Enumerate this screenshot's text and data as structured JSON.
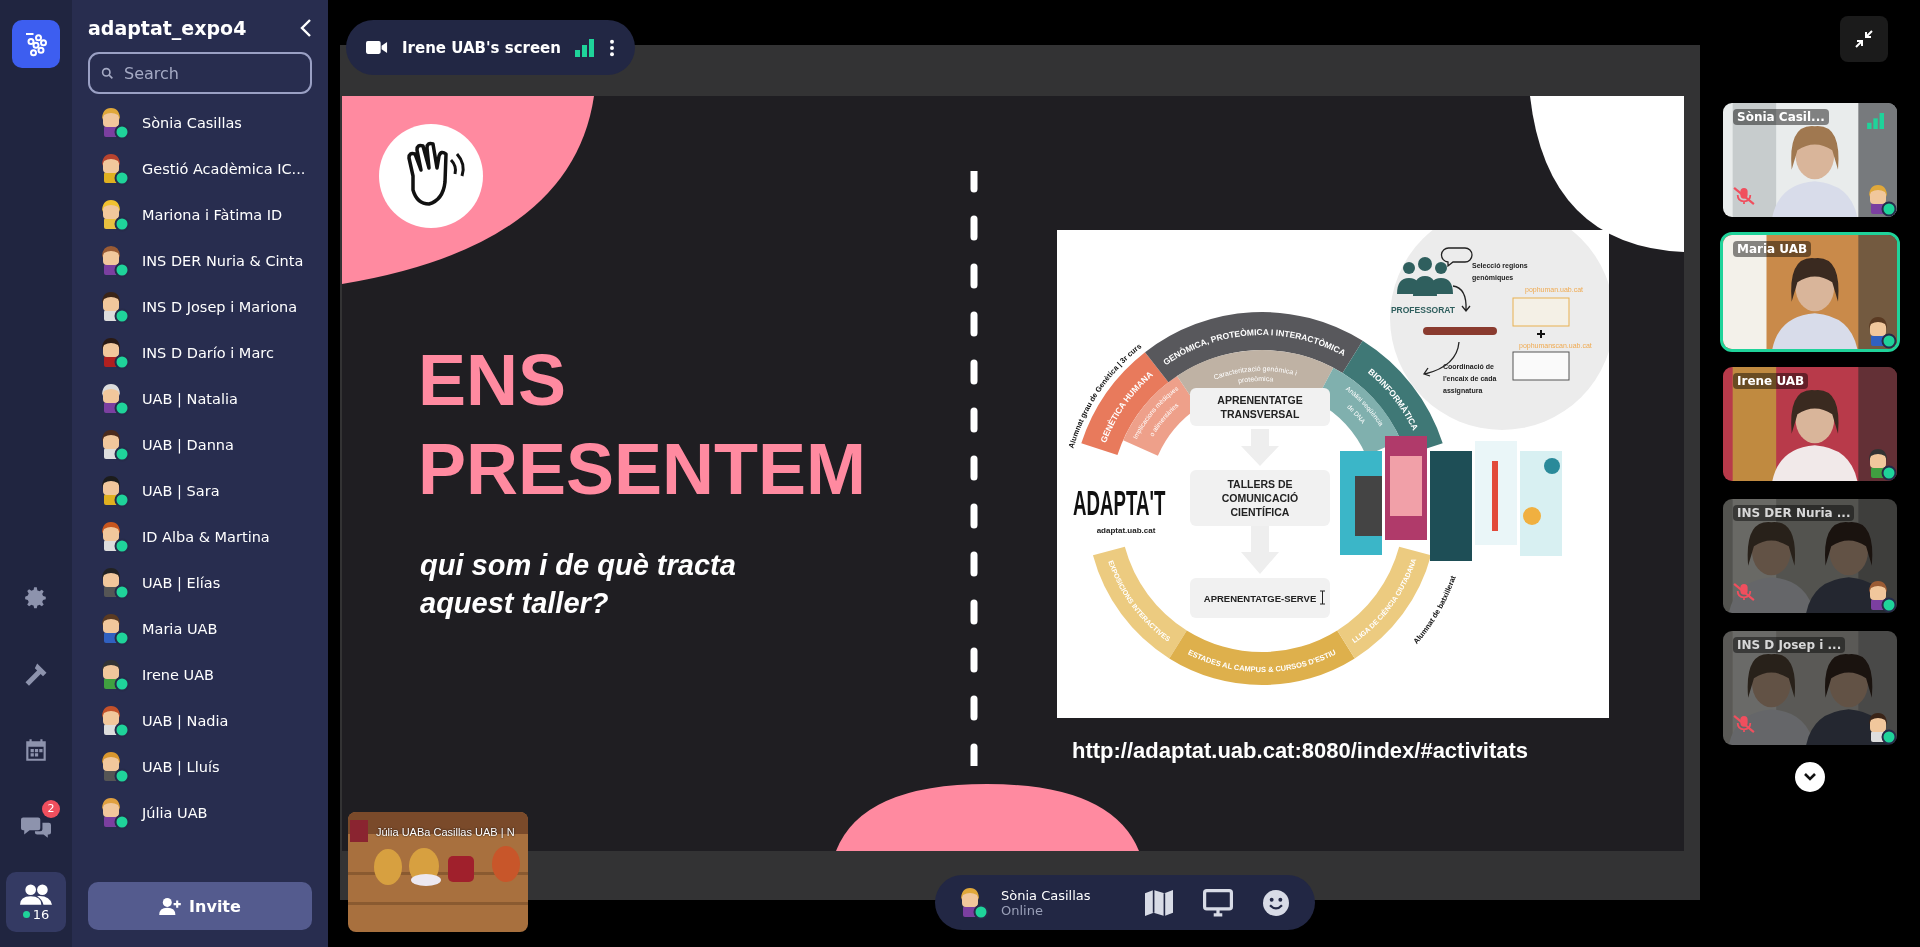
{
  "rail": {
    "items": [
      {
        "kind": "settings",
        "selected": false
      },
      {
        "kind": "build",
        "selected": false
      },
      {
        "kind": "calendar",
        "selected": false
      },
      {
        "kind": "chat",
        "selected": false,
        "badge": "2"
      },
      {
        "kind": "people",
        "selected": true,
        "count": "16"
      }
    ]
  },
  "sidebar": {
    "title": "adaptat_expo4",
    "search": {
      "placeholder": "Search"
    },
    "members": [
      {
        "name": "Sònia Casillas",
        "online": true
      },
      {
        "name": "Gestió Acadèmica IC...",
        "online": true
      },
      {
        "name": "Mariona i Fàtima ID",
        "online": true
      },
      {
        "name": "INS DER Nuria & Cinta",
        "online": true
      },
      {
        "name": "INS D Josep i Mariona",
        "online": true
      },
      {
        "name": "INS D Darío i Marc",
        "online": true
      },
      {
        "name": "UAB | Natalia",
        "online": true
      },
      {
        "name": "UAB | Danna",
        "online": true
      },
      {
        "name": "UAB | Sara",
        "online": true
      },
      {
        "name": "ID Alba & Martina",
        "online": true
      },
      {
        "name": "UAB | Elías",
        "online": true
      },
      {
        "name": "Maria UAB",
        "online": true
      },
      {
        "name": "Irene UAB",
        "online": true
      },
      {
        "name": "UAB | Nadia",
        "online": true
      },
      {
        "name": "UAB | Lluís",
        "online": true
      },
      {
        "name": "Júlia UAB",
        "online": true
      }
    ],
    "invite": "Invite"
  },
  "screen_share": {
    "title": "Irene UAB's screen",
    "slide": {
      "title_lines": [
        "ENS",
        "PRESENTEM"
      ],
      "subtitle_lines": [
        "qui som i de què tracta",
        "aquest taller?"
      ],
      "url": "http://adaptat.uab.cat:8080/index/#activitats",
      "diagram": {
        "top_arc": {
          "outer_label": "Alumnat grau de Genètica | 3r curs",
          "segments": [
            {
              "label": "GENÈTICA HUMANA",
              "color": "#e87a5c",
              "inner_lines": [
                "Implicacions mèdiques",
                "o alimentàries"
              ]
            },
            {
              "label": "GENÒMICA, PROTEÒMICA I INTERACTÒMICA",
              "color": "#58585c",
              "inner_lines": [
                "Caracterització genòmica i",
                "proteòmica"
              ]
            },
            {
              "label": "BIOINFORMÀTICA",
              "color": "#3f7876",
              "inner_lines": [
                "Anàlisi seqüència",
                "de DNA"
              ]
            }
          ]
        },
        "bottom_arc": {
          "outer_label": "Alumnat de batxillerat",
          "segments": [
            {
              "label": "EXPOSICIONS INTERACTIVES",
              "color": "#eccb80"
            },
            {
              "label": "ESTADES AL CAMPUS & CURSOS D'ESTIU",
              "color": "#deb04c"
            },
            {
              "label": "LLIGA DE CIÈNCIA CIUTADANA",
              "color": "#eccb80"
            }
          ]
        },
        "steps": [
          {
            "lines": [
              "APRENENTATGE",
              "TRANSVERSAL"
            ]
          },
          {
            "lines": [
              "TALLERS DE",
              "COMUNICACIÓ",
              "CIENTÍFICA"
            ]
          },
          {
            "lines": [
              "APRENENTATGE-SERVE"
            ]
          }
        ],
        "logo": "ADAPTA'T",
        "logo_url": "adaptat.uab.cat",
        "professorat": {
          "label": "PROFESSORAT",
          "step1_lines": [
            "Selecció regions",
            "genòmiques"
          ],
          "step2_lines": [
            "Coordinació de",
            "l'encaix de cada",
            "assignatura"
          ],
          "sites": [
            "pophuman.uab.cat",
            "pophumanscan.uab.cat"
          ]
        }
      }
    }
  },
  "minimap": {
    "labels": "Júlia UABa Casillas  UAB | N"
  },
  "video_tiles": [
    {
      "name": "Sònia Casil...",
      "muted": true,
      "speaking": false,
      "faded": false
    },
    {
      "name": "Maria UAB",
      "muted": false,
      "speaking": true,
      "faded": false
    },
    {
      "name": "Irene UAB",
      "muted": false,
      "speaking": false,
      "faded": false
    },
    {
      "name": "INS DER Nuria ...",
      "muted": true,
      "speaking": false,
      "faded": true
    },
    {
      "name": "INS D Josep i ...",
      "muted": true,
      "speaking": false,
      "faded": true
    }
  ],
  "self": {
    "name": "Sònia Casillas",
    "status": "Online"
  }
}
